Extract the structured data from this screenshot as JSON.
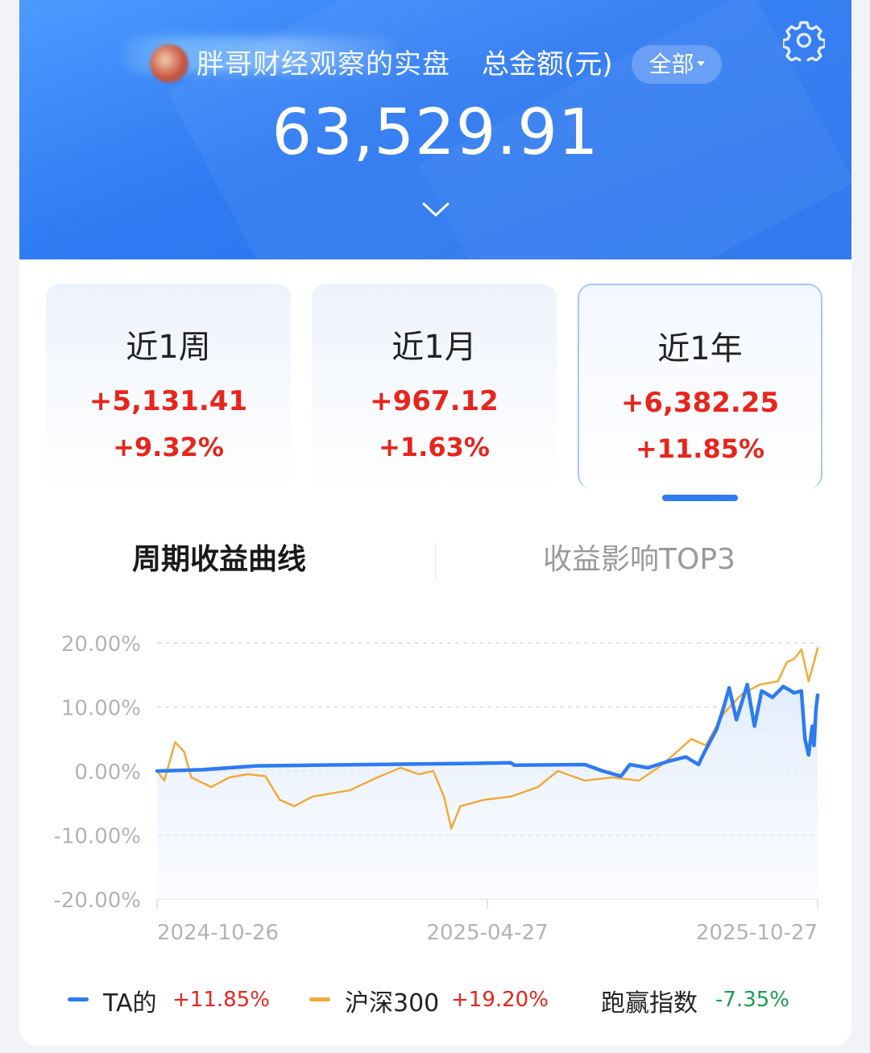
{
  "header": {
    "owner_name": "胖哥财经观察的实盘",
    "total_label": "总金额(元)",
    "scope_button": "全部",
    "total_amount": "63,529.91",
    "icons": {
      "settings": "gear-icon",
      "expand": "chevron-down-icon"
    }
  },
  "periods": [
    {
      "label": "近1周",
      "amount": "+5,131.41",
      "percent": "+9.32%"
    },
    {
      "label": "近1月",
      "amount": "+967.12",
      "percent": "+1.63%"
    },
    {
      "label": "近1年",
      "amount": "+6,382.25",
      "percent": "+11.85%",
      "selected": true
    }
  ],
  "tabs": [
    {
      "label": "周期收益曲线",
      "active": true
    },
    {
      "label": "收益影响TOP3",
      "active": false
    }
  ],
  "colors": {
    "blue": "#2e7bf0",
    "orange": "#f3a93a",
    "red": "#e8251c",
    "green": "#1a9e52"
  },
  "legend": {
    "ta": {
      "name": "TA的",
      "value": "+11.85%"
    },
    "index": {
      "name": "沪深300",
      "value": "+19.20%"
    },
    "beat": {
      "name": "跑赢指数",
      "value": "-7.35%"
    }
  },
  "chart_data": {
    "type": "line",
    "y_ticks": [
      "20.00%",
      "10.00%",
      "0.00%",
      "-10.00%",
      "-20.00%"
    ],
    "x_ticks": [
      "2024-10-26",
      "2025-04-27",
      "2025-10-27"
    ],
    "ylim": [
      -20,
      20
    ],
    "grid": true,
    "series": [
      {
        "name": "TA的",
        "color": "#2e7bf0",
        "points": [
          [
            "2024-10-26",
            0
          ],
          [
            "2024-11-20",
            0.2
          ],
          [
            "2024-12-20",
            0.8
          ],
          [
            "2025-01-20",
            0.9
          ],
          [
            "2025-02-20",
            1.0
          ],
          [
            "2025-03-20",
            1.1
          ],
          [
            "2025-04-20",
            1.2
          ],
          [
            "2025-05-10",
            1.3
          ],
          [
            "2025-05-12",
            0.9
          ],
          [
            "2025-06-20",
            1.0
          ],
          [
            "2025-06-30",
            0.0
          ],
          [
            "2025-07-10",
            -0.8
          ],
          [
            "2025-07-15",
            1.0
          ],
          [
            "2025-07-25",
            0.5
          ],
          [
            "2025-08-05",
            1.5
          ],
          [
            "2025-08-15",
            2.2
          ],
          [
            "2025-08-22",
            1.0
          ],
          [
            "2025-08-25",
            2.8
          ],
          [
            "2025-09-01",
            6.5
          ],
          [
            "2025-09-05",
            10.0
          ],
          [
            "2025-09-08",
            13.0
          ],
          [
            "2025-09-12",
            8.0
          ],
          [
            "2025-09-18",
            13.5
          ],
          [
            "2025-09-22",
            7.0
          ],
          [
            "2025-09-26",
            12.5
          ],
          [
            "2025-10-02",
            11.5
          ],
          [
            "2025-10-08",
            13.2
          ],
          [
            "2025-10-14",
            12.2
          ],
          [
            "2025-10-18",
            12.5
          ],
          [
            "2025-10-20",
            5.0
          ],
          [
            "2025-10-22",
            2.5
          ],
          [
            "2025-10-24",
            7.0
          ],
          [
            "2025-10-25",
            4.0
          ],
          [
            "2025-10-26",
            9.5
          ],
          [
            "2025-10-27",
            11.85
          ]
        ]
      },
      {
        "name": "沪深300",
        "color": "#f3a93a",
        "points": [
          [
            "2024-10-26",
            0
          ],
          [
            "2024-10-30",
            -1.5
          ],
          [
            "2024-11-05",
            4.5
          ],
          [
            "2024-11-10",
            3.0
          ],
          [
            "2024-11-14",
            -1.0
          ],
          [
            "2024-11-25",
            -2.5
          ],
          [
            "2024-12-05",
            -1.0
          ],
          [
            "2024-12-15",
            -0.5
          ],
          [
            "2024-12-25",
            -0.8
          ],
          [
            "2025-01-02",
            -4.5
          ],
          [
            "2025-01-10",
            -5.5
          ],
          [
            "2025-01-20",
            -4.0
          ],
          [
            "2025-02-10",
            -3.0
          ],
          [
            "2025-02-25",
            -1.0
          ],
          [
            "2025-03-10",
            0.5
          ],
          [
            "2025-03-20",
            -0.5
          ],
          [
            "2025-03-28",
            0.0
          ],
          [
            "2025-04-03",
            -4.0
          ],
          [
            "2025-04-07",
            -9.0
          ],
          [
            "2025-04-12",
            -5.5
          ],
          [
            "2025-04-25",
            -4.5
          ],
          [
            "2025-05-10",
            -4.0
          ],
          [
            "2025-05-25",
            -2.5
          ],
          [
            "2025-06-05",
            0.0
          ],
          [
            "2025-06-20",
            -1.5
          ],
          [
            "2025-07-05",
            -1.0
          ],
          [
            "2025-07-20",
            -1.5
          ],
          [
            "2025-08-01",
            0.8
          ],
          [
            "2025-08-10",
            3.0
          ],
          [
            "2025-08-18",
            5.0
          ],
          [
            "2025-08-26",
            4.0
          ],
          [
            "2025-09-05",
            9.0
          ],
          [
            "2025-09-15",
            12.0
          ],
          [
            "2025-09-25",
            13.5
          ],
          [
            "2025-10-05",
            14.0
          ],
          [
            "2025-10-10",
            17.0
          ],
          [
            "2025-10-14",
            17.5
          ],
          [
            "2025-10-18",
            19.0
          ],
          [
            "2025-10-22",
            14.0
          ],
          [
            "2025-10-25",
            17.0
          ],
          [
            "2025-10-27",
            19.2
          ]
        ]
      }
    ]
  }
}
